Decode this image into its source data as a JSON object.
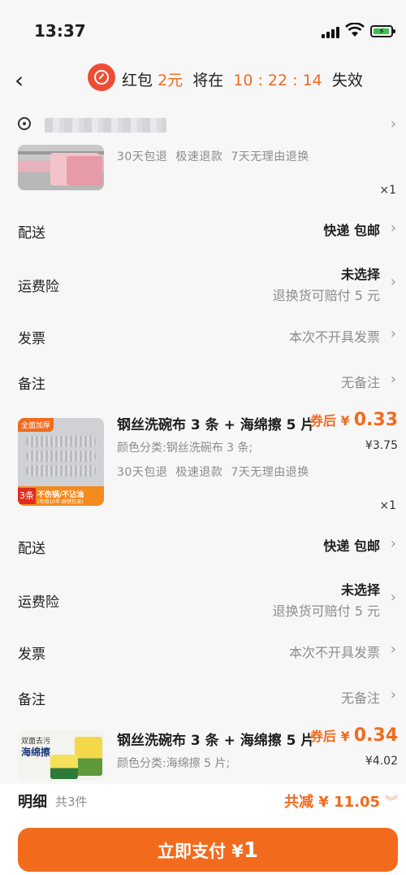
{
  "status_bar": {
    "time": "13:37"
  },
  "header": {
    "hongbao_label": "红包",
    "hongbao_amount": "2元",
    "expire_prefix": "将在",
    "countdown": "10 : 22 : 14",
    "expire_suffix": "失效"
  },
  "product1": {
    "services": [
      "30天包退",
      "极速退款",
      "7天无理由退换"
    ],
    "qty": "×1"
  },
  "group1": {
    "delivery": {
      "label": "配送",
      "value": "快递 包邮"
    },
    "insurance": {
      "label": "运费险",
      "value": "未选择",
      "sub": "退换货可赔付 5 元"
    },
    "invoice": {
      "label": "发票",
      "value": "本次不开具发票"
    },
    "note": {
      "label": "备注",
      "value": "无备注"
    }
  },
  "product2": {
    "title": "钢丝洗碗布 3 条 + 海绵擦 5 片",
    "price_label": "券后 ¥",
    "price": "0.33",
    "variant": "颜色分类:钢丝洗碗布 3 条;",
    "orig_price": "¥3.75",
    "services": [
      "30天包退",
      "极速退款",
      "7天无理由退换"
    ],
    "qty": "×1",
    "image_text": {
      "top": "全面加厚",
      "num": "3条",
      "line1": "不伤锅/不沾油",
      "line2": "(可用10年-耐锈包退)"
    }
  },
  "group2": {
    "delivery": {
      "label": "配送",
      "value": "快递 包邮"
    },
    "insurance": {
      "label": "运费险",
      "value": "未选择",
      "sub": "退换货可赔付 5 元"
    },
    "invoice": {
      "label": "发票",
      "value": "本次不开具发票"
    },
    "note": {
      "label": "备注",
      "value": "无备注"
    }
  },
  "product3": {
    "title": "钢丝洗碗布 3 条 + 海绵擦 5 片",
    "price_label": "券后 ¥",
    "price": "0.34",
    "variant": "颜色分类:海绵擦 5 片;",
    "orig_price": "¥4.02",
    "image_text": {
      "line1": "双面去污",
      "line2": "海绵擦"
    }
  },
  "footer": {
    "detail_label": "明细",
    "item_count": "共3件",
    "discount": "共减 ¥ 11.05",
    "pay_label": "立即支付 ¥",
    "pay_amount": "1"
  },
  "icons": [
    "back-icon",
    "hongbao-timer-icon",
    "location-icon",
    "chevron-right-icon",
    "chevron-down-icon"
  ]
}
